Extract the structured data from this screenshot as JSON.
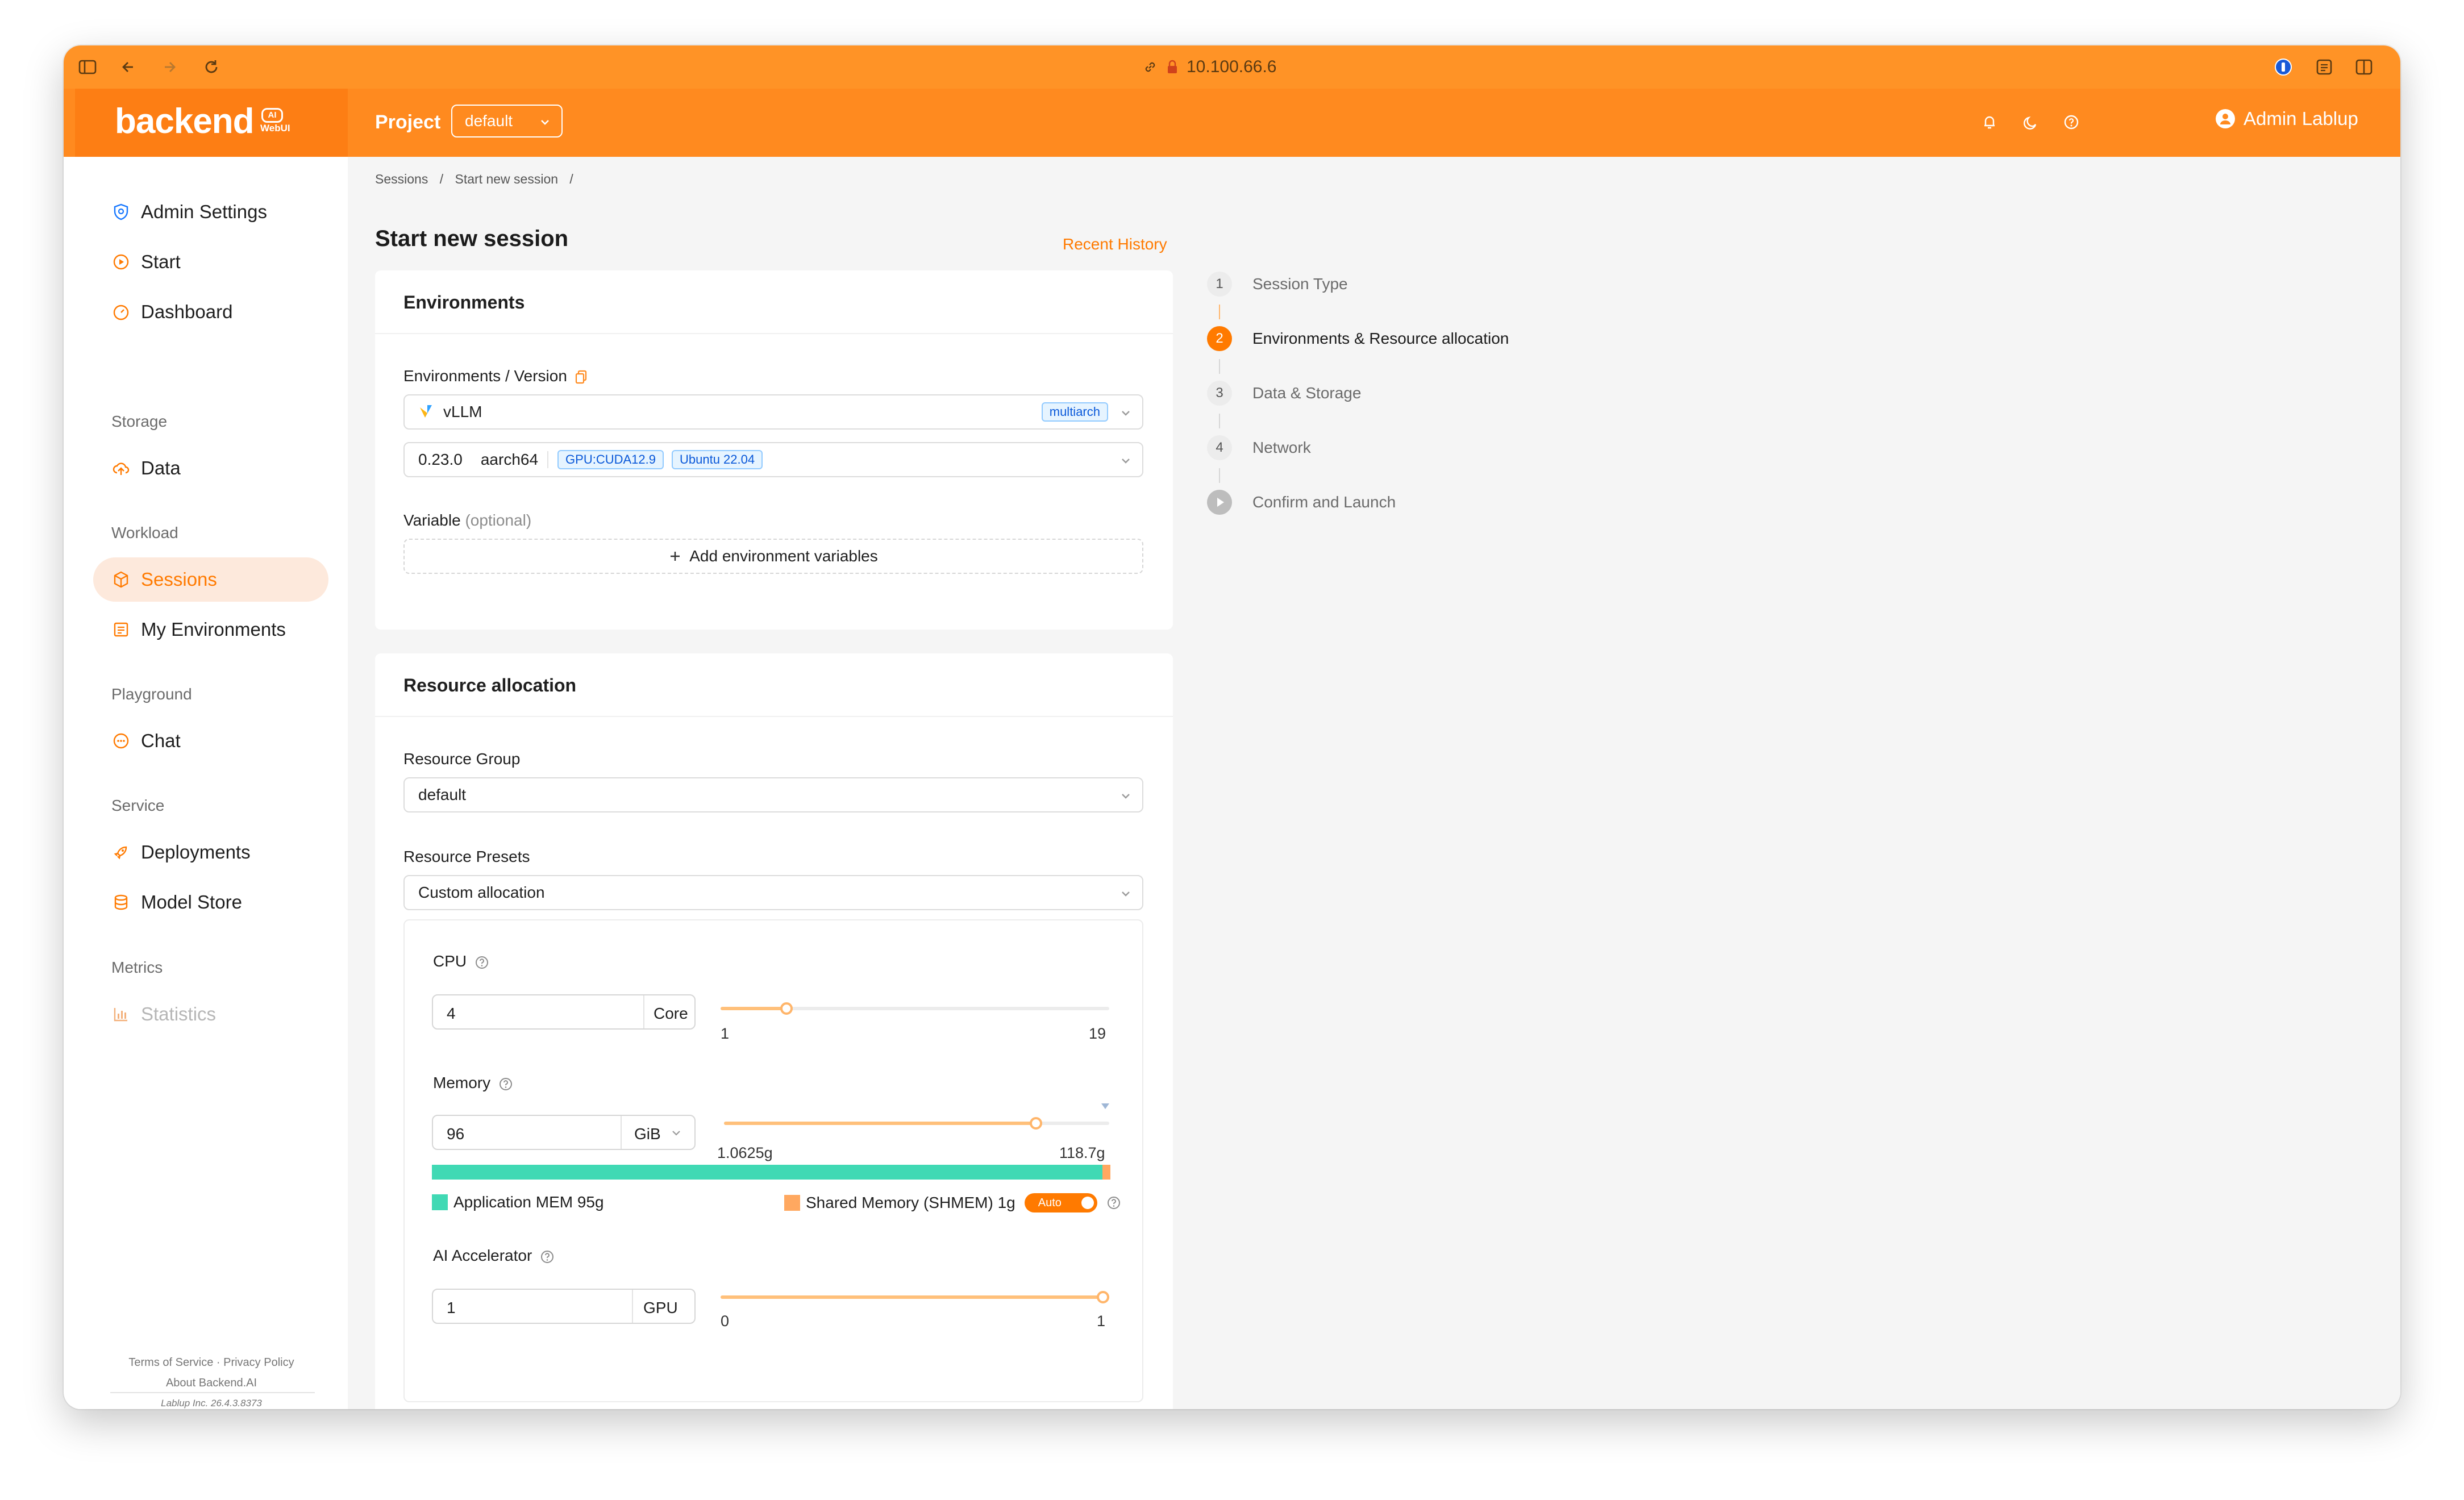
{
  "browser": {
    "url": "10.100.66.6"
  },
  "header": {
    "logo": "backend",
    "logo_badge": "AI",
    "logo_sub": "WebUI",
    "project_label": "Project",
    "project_value": "default",
    "user_name": "Admin Lablup"
  },
  "sidebar": {
    "admin_settings": "Admin Settings",
    "start": "Start",
    "dashboard": "Dashboard",
    "group_storage": "Storage",
    "data": "Data",
    "group_workload": "Workload",
    "sessions": "Sessions",
    "my_environments": "My Environments",
    "group_playground": "Playground",
    "chat": "Chat",
    "group_service": "Service",
    "deployments": "Deployments",
    "model_store": "Model Store",
    "group_metrics": "Metrics",
    "statistics": "Statistics",
    "footer_terms": "Terms of Service",
    "footer_privacy": "Privacy Policy",
    "footer_about": "About Backend.AI",
    "footer_company": "Lablup Inc.",
    "footer_version": "26.4.3.8373"
  },
  "breadcrumb": {
    "item1": "Sessions",
    "item2": "Start new session",
    "sep": "/"
  },
  "page": {
    "title": "Start new session",
    "recent_history": "Recent History"
  },
  "environments": {
    "heading": "Environments",
    "env_version_label": "Environments / Version",
    "env_value": "vLLM",
    "env_tag": "multiarch",
    "version": "0.23.0",
    "arch": "aarch64",
    "tag_gpu": "GPU:CUDA12.9",
    "tag_os": "Ubuntu 22.04",
    "variable_label": "Variable",
    "variable_optional": "(optional)",
    "add_env_vars": "Add environment variables"
  },
  "resource": {
    "heading": "Resource allocation",
    "group_label": "Resource Group",
    "group_value": "default",
    "presets_label": "Resource Presets",
    "presets_value": "Custom allocation",
    "cpu_label": "CPU",
    "cpu_value": "4",
    "cpu_unit": "Core",
    "cpu_min": "1",
    "cpu_max": "19",
    "cpu_level": 0.17,
    "memory_label": "Memory",
    "memory_value": "96",
    "memory_unit": "GiB",
    "memory_min": "1.0625g",
    "memory_max": "118.7g",
    "memory_level": 0.81,
    "app_mem_legend": "Application MEM 95g",
    "shmem_legend": "Shared Memory (SHMEM) 1g",
    "auto_label": "Auto",
    "accel_label": "AI Accelerator",
    "accel_value": "1",
    "accel_unit": "GPU",
    "accel_min": "0",
    "accel_max": "1",
    "accel_level": 1.0
  },
  "steps": [
    {
      "n": "1",
      "label": "Session Type"
    },
    {
      "n": "2",
      "label": "Environments & Resource allocation"
    },
    {
      "n": "3",
      "label": "Data & Storage"
    },
    {
      "n": "4",
      "label": "Network"
    },
    {
      "n": "",
      "label": "Confirm and Launch"
    }
  ],
  "colors": {
    "accent": "#ff7a00",
    "header": "#ff8a1f",
    "app_mem": "#40d9b4",
    "shmem": "#ffa860"
  }
}
